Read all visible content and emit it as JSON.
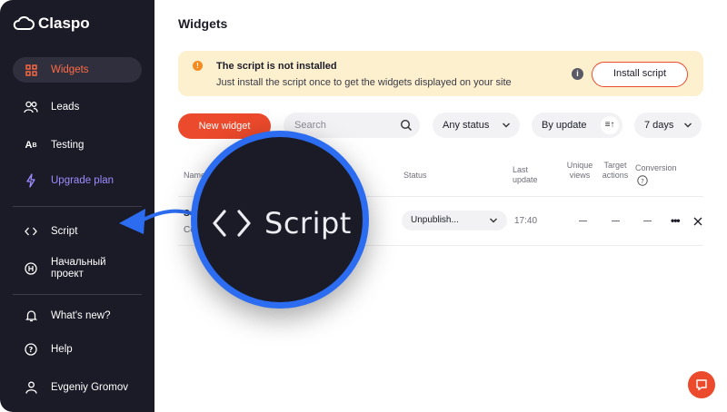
{
  "app": {
    "brand": "Claspo"
  },
  "sidebar": {
    "items": [
      {
        "label": "Widgets",
        "icon": "grid-icon",
        "active": true
      },
      {
        "label": "Leads",
        "icon": "users-icon"
      },
      {
        "label": "Testing",
        "icon": "ab-test-icon"
      },
      {
        "label": "Upgrade plan",
        "icon": "lightning-icon"
      },
      {
        "label": "Script",
        "icon": "code-icon"
      },
      {
        "label": "Начальный проект",
        "icon": "project-h-icon"
      },
      {
        "label": "What's new?",
        "icon": "bell-icon"
      },
      {
        "label": "Help",
        "icon": "help-icon"
      },
      {
        "label": "Evgeniy Gromov",
        "icon": "user-icon"
      }
    ]
  },
  "page": {
    "title": "Widgets"
  },
  "banner": {
    "title": "The script is not installed",
    "subtitle": "Just install the script once to get the widgets displayed on your site",
    "button": "Install script"
  },
  "toolbar": {
    "new_widget": "New widget",
    "search_placeholder": "Search",
    "status_filter": "Any status",
    "sort": "By update",
    "period": "7 days"
  },
  "table": {
    "headers": {
      "name": "Name",
      "status": "Status",
      "last_update": "Last update",
      "unique_views": "Unique views",
      "target_actions": "Target actions",
      "conversion": "Conversion"
    },
    "rows": [
      {
        "name_fragment": "S",
        "sub_fragment": "Co",
        "status": "Unpublish...",
        "last_update": "17:40",
        "unique_views": "—",
        "target_actions": "—",
        "conversion": "—"
      }
    ]
  },
  "magnifier": {
    "label": "Script",
    "icon": "code-icon"
  },
  "colors": {
    "sidebar_bg": "#1b1b27",
    "accent": "#ec4a2c",
    "banner_bg": "#fdf0cf",
    "highlight_ring": "#2b6cf0",
    "upgrade": "#9d8cff"
  }
}
